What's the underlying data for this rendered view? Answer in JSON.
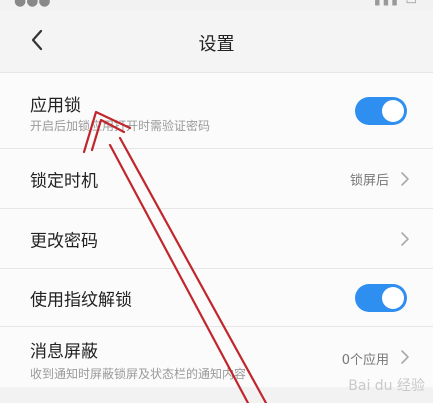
{
  "header": {
    "title": "设置"
  },
  "settings": [
    {
      "label": "应用锁",
      "subtitle": "开启后加锁应用打开时需验证密码",
      "toggle_on": true
    },
    {
      "label": "锁定时机",
      "value": "锁屏后"
    },
    {
      "label": "更改密码"
    },
    {
      "label": "使用指纹解锁",
      "toggle_on": true
    },
    {
      "label": "消息屏蔽",
      "subtitle": "收到通知时屏蔽锁屏及状态栏的通知内容",
      "value": "0个应用"
    }
  ],
  "colors": {
    "accent": "#2f8ff0",
    "annotation_arrow": "#c0272d",
    "background": "#f2f2f2"
  },
  "watermark": "Bai du 经验"
}
